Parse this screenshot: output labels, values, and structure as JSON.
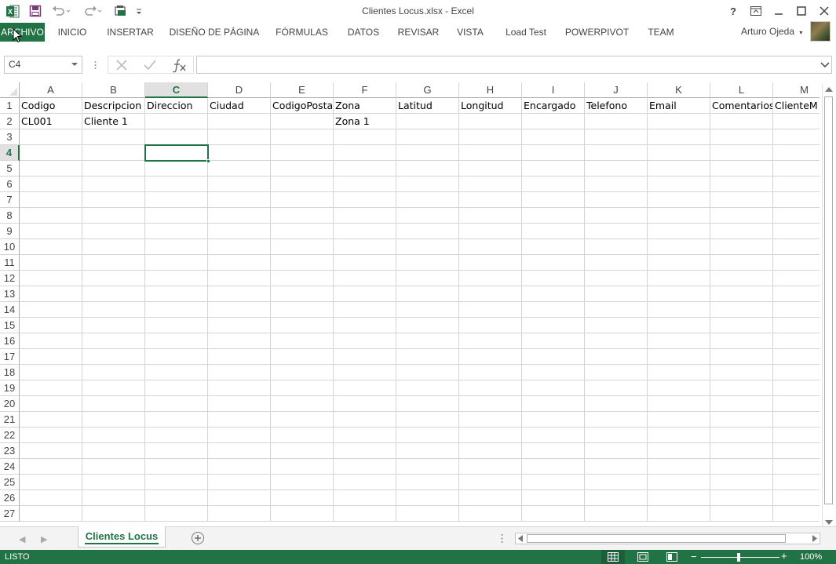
{
  "window": {
    "title": "Clientes Locus.xlsx - Excel",
    "help_label": "?"
  },
  "qat": {
    "icons": [
      "save-icon",
      "undo-icon",
      "redo-icon",
      "touch-mode-icon",
      "customize-qat-icon"
    ]
  },
  "ribbon": {
    "tabs": [
      {
        "label": "ARCHIVO"
      },
      {
        "label": "INICIO"
      },
      {
        "label": "INSERTAR"
      },
      {
        "label": "DISEÑO DE PÁGINA"
      },
      {
        "label": "FÓRMULAS"
      },
      {
        "label": "DATOS"
      },
      {
        "label": "REVISAR"
      },
      {
        "label": "VISTA"
      },
      {
        "label": "Load Test"
      },
      {
        "label": "POWERPIVOT"
      },
      {
        "label": "TEAM"
      }
    ],
    "user_name": "Arturo Ojeda"
  },
  "formula_bar": {
    "name_box": "C4",
    "formula": ""
  },
  "sheet": {
    "columns": [
      "A",
      "B",
      "C",
      "D",
      "E",
      "F",
      "G",
      "H",
      "I",
      "J",
      "K",
      "L",
      "M"
    ],
    "selected_column": "C",
    "selected_row": 4,
    "rows": [
      "1",
      "2",
      "3",
      "4",
      "5",
      "6",
      "7",
      "8",
      "9",
      "10",
      "11",
      "12",
      "13",
      "14",
      "15",
      "16",
      "17",
      "18",
      "19",
      "20",
      "21",
      "22",
      "23",
      "24",
      "25",
      "26",
      "27"
    ],
    "row1": [
      "Codigo",
      "Descripcion",
      "Direccion",
      "Ciudad",
      "CodigoPostal",
      "Zona",
      "Latitud",
      "Longitud",
      "Encargado",
      "Telefono",
      "Email",
      "Comentarios",
      "ClienteM"
    ],
    "row2": [
      "CL001",
      "Cliente 1",
      "",
      "",
      "",
      "Zona 1",
      "",
      "",
      "",
      "",
      "",
      "",
      ""
    ]
  },
  "sheet_tabs": {
    "active": "Clientes Locus"
  },
  "status_bar": {
    "status": "LISTO",
    "zoom": "100%",
    "zoom_minus": "−",
    "zoom_plus": "+"
  },
  "colors": {
    "accent": "#217346",
    "grid_line": "#d4d4d4"
  }
}
